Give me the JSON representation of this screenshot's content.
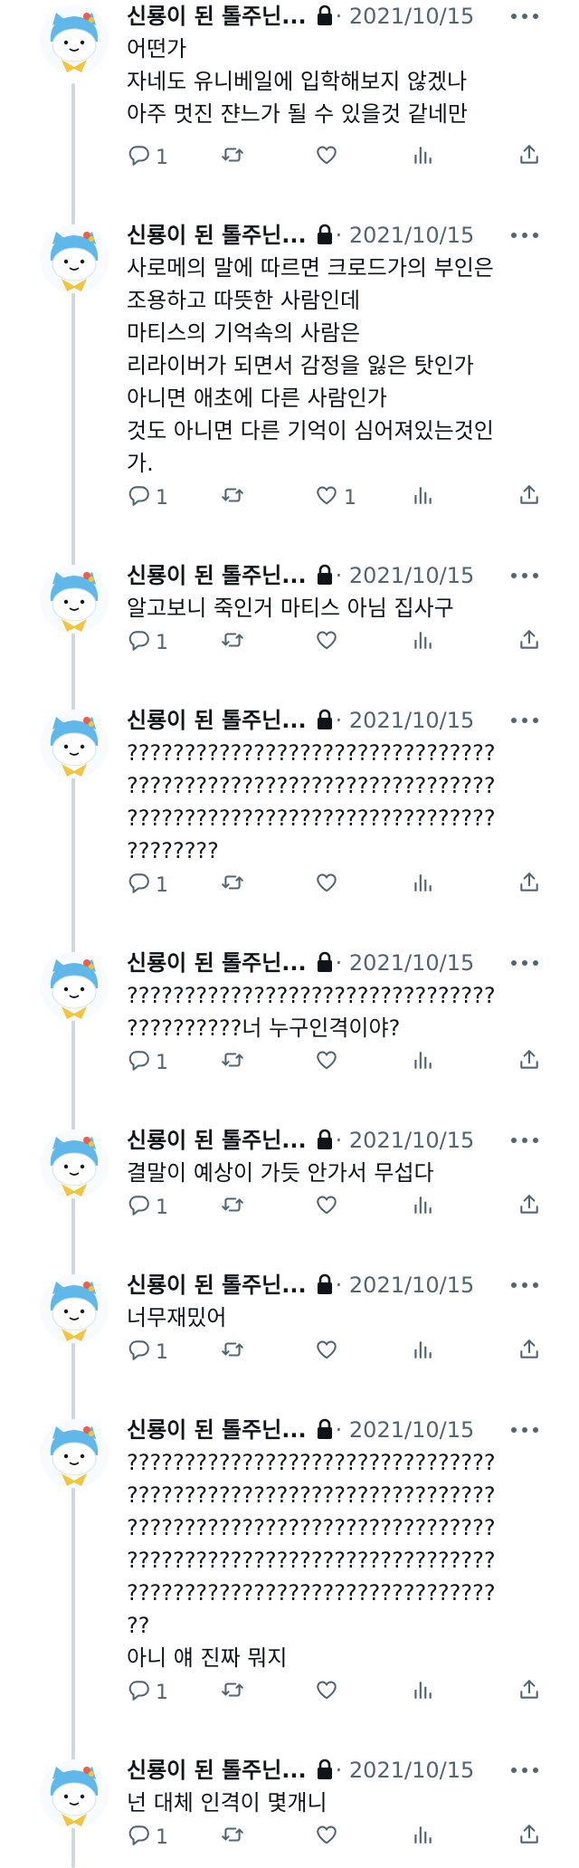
{
  "account": {
    "name": "신룡이 된 톨주닌...",
    "date": "2021/10/15",
    "separator": "·"
  },
  "tweets": [
    {
      "text": "어떤가\n자네도 유니베일에 입학해보지 않겠나\n아주 멋진 쟌느가 될 수 있을것 같네만",
      "replies": "1",
      "retweets": "",
      "likes": ""
    },
    {
      "text": "사로메의 말에 따르면 크로드가의 부인은\n조용하고 따뜻한 사람인데\n마티스의 기억속의 사람은\n리라이버가 되면서 감정을 잃은 탓인가\n아니면 애초에 다른 사람인가\n것도 아니면 다른 기억이 심어져있는것인\n가.",
      "replies": "1",
      "retweets": "",
      "likes": "1"
    },
    {
      "text": "알고보니 죽인거 마티스 아님 집사구",
      "replies": "1",
      "retweets": "",
      "likes": ""
    },
    {
      "text": "????????????????????????????????\n????????????????????????????????\n????????????????????????????????\n????????",
      "replies": "1",
      "retweets": "",
      "likes": ""
    },
    {
      "text": "????????????????????????????????\n??????????너 누구인격이야?",
      "replies": "1",
      "retweets": "",
      "likes": ""
    },
    {
      "text": "결말이 예상이 가듯 안가서 무섭다",
      "replies": "1",
      "retweets": "",
      "likes": ""
    },
    {
      "text": "너무재밌어",
      "replies": "1",
      "retweets": "",
      "likes": ""
    },
    {
      "text": "????????????????????????????????\n????????????????????????????????\n????????????????????????????????\n????????????????????????????????\n????????????????????????????????\n??\n아니 얘 진짜 뭐지",
      "replies": "1",
      "retweets": "",
      "likes": ""
    },
    {
      "text": "넌 대체 인격이 몇개니",
      "replies": "1",
      "retweets": "",
      "likes": ""
    }
  ],
  "icons": {
    "avatar": "cartoon-cat-avatar-icon",
    "lock": "lock-icon",
    "more": "more-icon",
    "reply": "reply-icon",
    "retweet": "retweet-icon",
    "like": "like-icon",
    "views": "views-icon",
    "share": "share-icon"
  },
  "colors": {
    "text": "#0f1419",
    "secondary": "#536471",
    "thread_line": "#cfd9de",
    "avatar_blue": "#5fb7ea",
    "scarf": "#f3c53a"
  }
}
